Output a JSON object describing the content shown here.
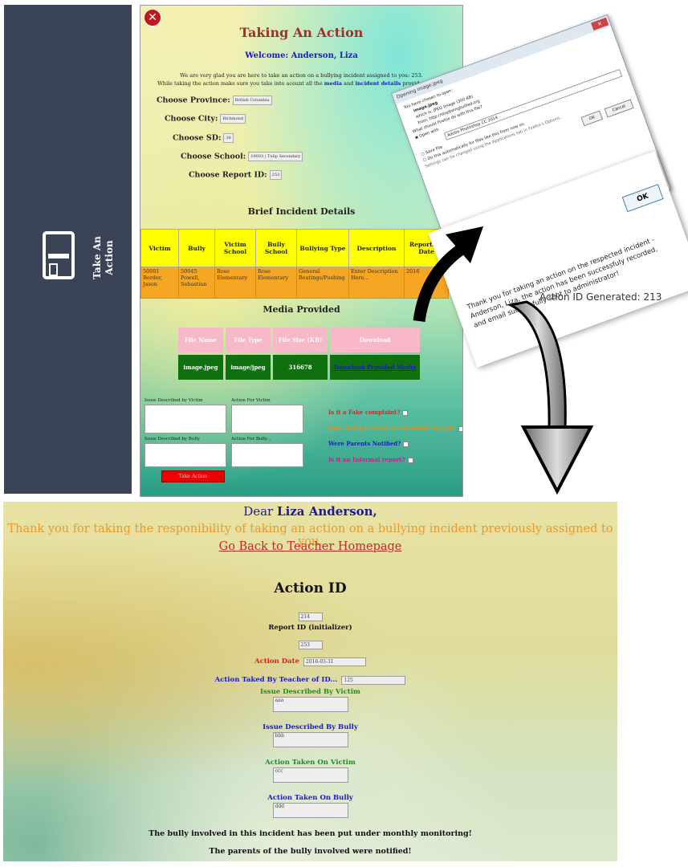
{
  "sidebar": {
    "nav_label": "Take An Action"
  },
  "form": {
    "title": "Taking An Action",
    "welcome": "Welcome: Anderson, Liza",
    "intro_line1": "We are very glad you are here to take an action on a bullying incident assigned to you: 253.",
    "intro_line2_pre": "While taking the action make sure you take into acount all the",
    "intro_media": "media",
    "intro_and": "and",
    "intro_details": "incident details",
    "intro_post": "provided to you.",
    "province_label": "Choose Province:",
    "province_value": "British Columbia",
    "city_label": "Choose City:",
    "city_value": "Richmond",
    "sd_label": "Choose SD:",
    "sd_value": "38",
    "school_label": "Choose School:",
    "school_value": "10003 | Tulip Secondary",
    "report_label": "Choose Report ID:",
    "report_value": "253",
    "incident_title": "Brief Incident Details",
    "incident_headers": [
      "Victim",
      "Bully",
      "Victim School",
      "Bully School",
      "Bullying Type",
      "Description",
      "Reporting Date"
    ],
    "incident_row": [
      "50001 Border, Jason",
      "50045 Powell, Sebastian",
      "Rose Elementary",
      "Rose Elementary",
      "General Beatings/Pushing",
      "Enter Description Here...",
      "2016"
    ],
    "media_title": "Media Provided",
    "media_headers": [
      "File Name",
      "File Type",
      "File Size (KB)",
      "Download"
    ],
    "media_row": [
      "image.jpeg",
      "image/jpeg",
      "316678",
      "Download Provided Media"
    ],
    "ta_victim_issue": "Issue Described by Victim",
    "ta_action_victim": "Action For Victim",
    "ta_bully_issue": "Issue Described by Bully",
    "ta_action_bully": "Action For Bully...",
    "q_fake": "Is it a Fake complaint?",
    "q_monitor": "Does Bully nees to be monitored by you?",
    "q_parents": "Were Parents Notified?",
    "q_police": "Is it an Informal report?",
    "submit": "Take Action"
  },
  "dialog": {
    "titlebar": "Opening image.jpeg",
    "line1": "You have chosen to open:",
    "file_name": "image.jpeg",
    "which_is": "which is: JPEG Image (300 KB)",
    "from": "from: http://stopbeingbullied.org",
    "question": "What should Firefox do with this file?",
    "open_with": "Open with",
    "app": "Adobe Photoshop CC 2014",
    "save_file": "Save File",
    "auto": "Do this automatically for files like this from now on.",
    "settings": "Settings can be changed using the Applications tab in Firefox's Options.",
    "ok": "OK",
    "cancel": "Cancel"
  },
  "msgbox": {
    "message": "Thank you for taking an action on the respected incident - Anderson, Liza, the action has been successfuly recorded, and email successfully sent to administrator!",
    "ok": "OK"
  },
  "action_id_caption": "Action ID Generated: 213",
  "confirm": {
    "dear_prefix": "Dear",
    "dear_name": "Liza Anderson,",
    "thanks": "Thank you for taking the responibility of taking an action on a bullying incident previously assigned to you.",
    "back_link": "Go Back to Teacher Homepage",
    "action_id_heading": "Action ID",
    "action_id_value": "214",
    "report_label": "Report ID (initializer)",
    "report_value": "253",
    "date_label": "Action Date",
    "date_value": "2016-03-31",
    "teacher_label": "Action Taked By Teacher of ID...",
    "teacher_value": "125",
    "victim_issue_label": "Issue Described By Victim",
    "victim_issue_value": "aaa",
    "bully_issue_label": "Issue Described By Bully",
    "bully_issue_value": "bbb",
    "action_victim_label": "Action Taken On Victim",
    "action_victim_value": "ccc",
    "action_bully_label": "Action Taken On Bully",
    "action_bully_value": "ddd",
    "note_monitor": "The bully involved in this incident has been put under monthly monitoring!",
    "note_parents": "The parents of the bully involved were notified!"
  }
}
